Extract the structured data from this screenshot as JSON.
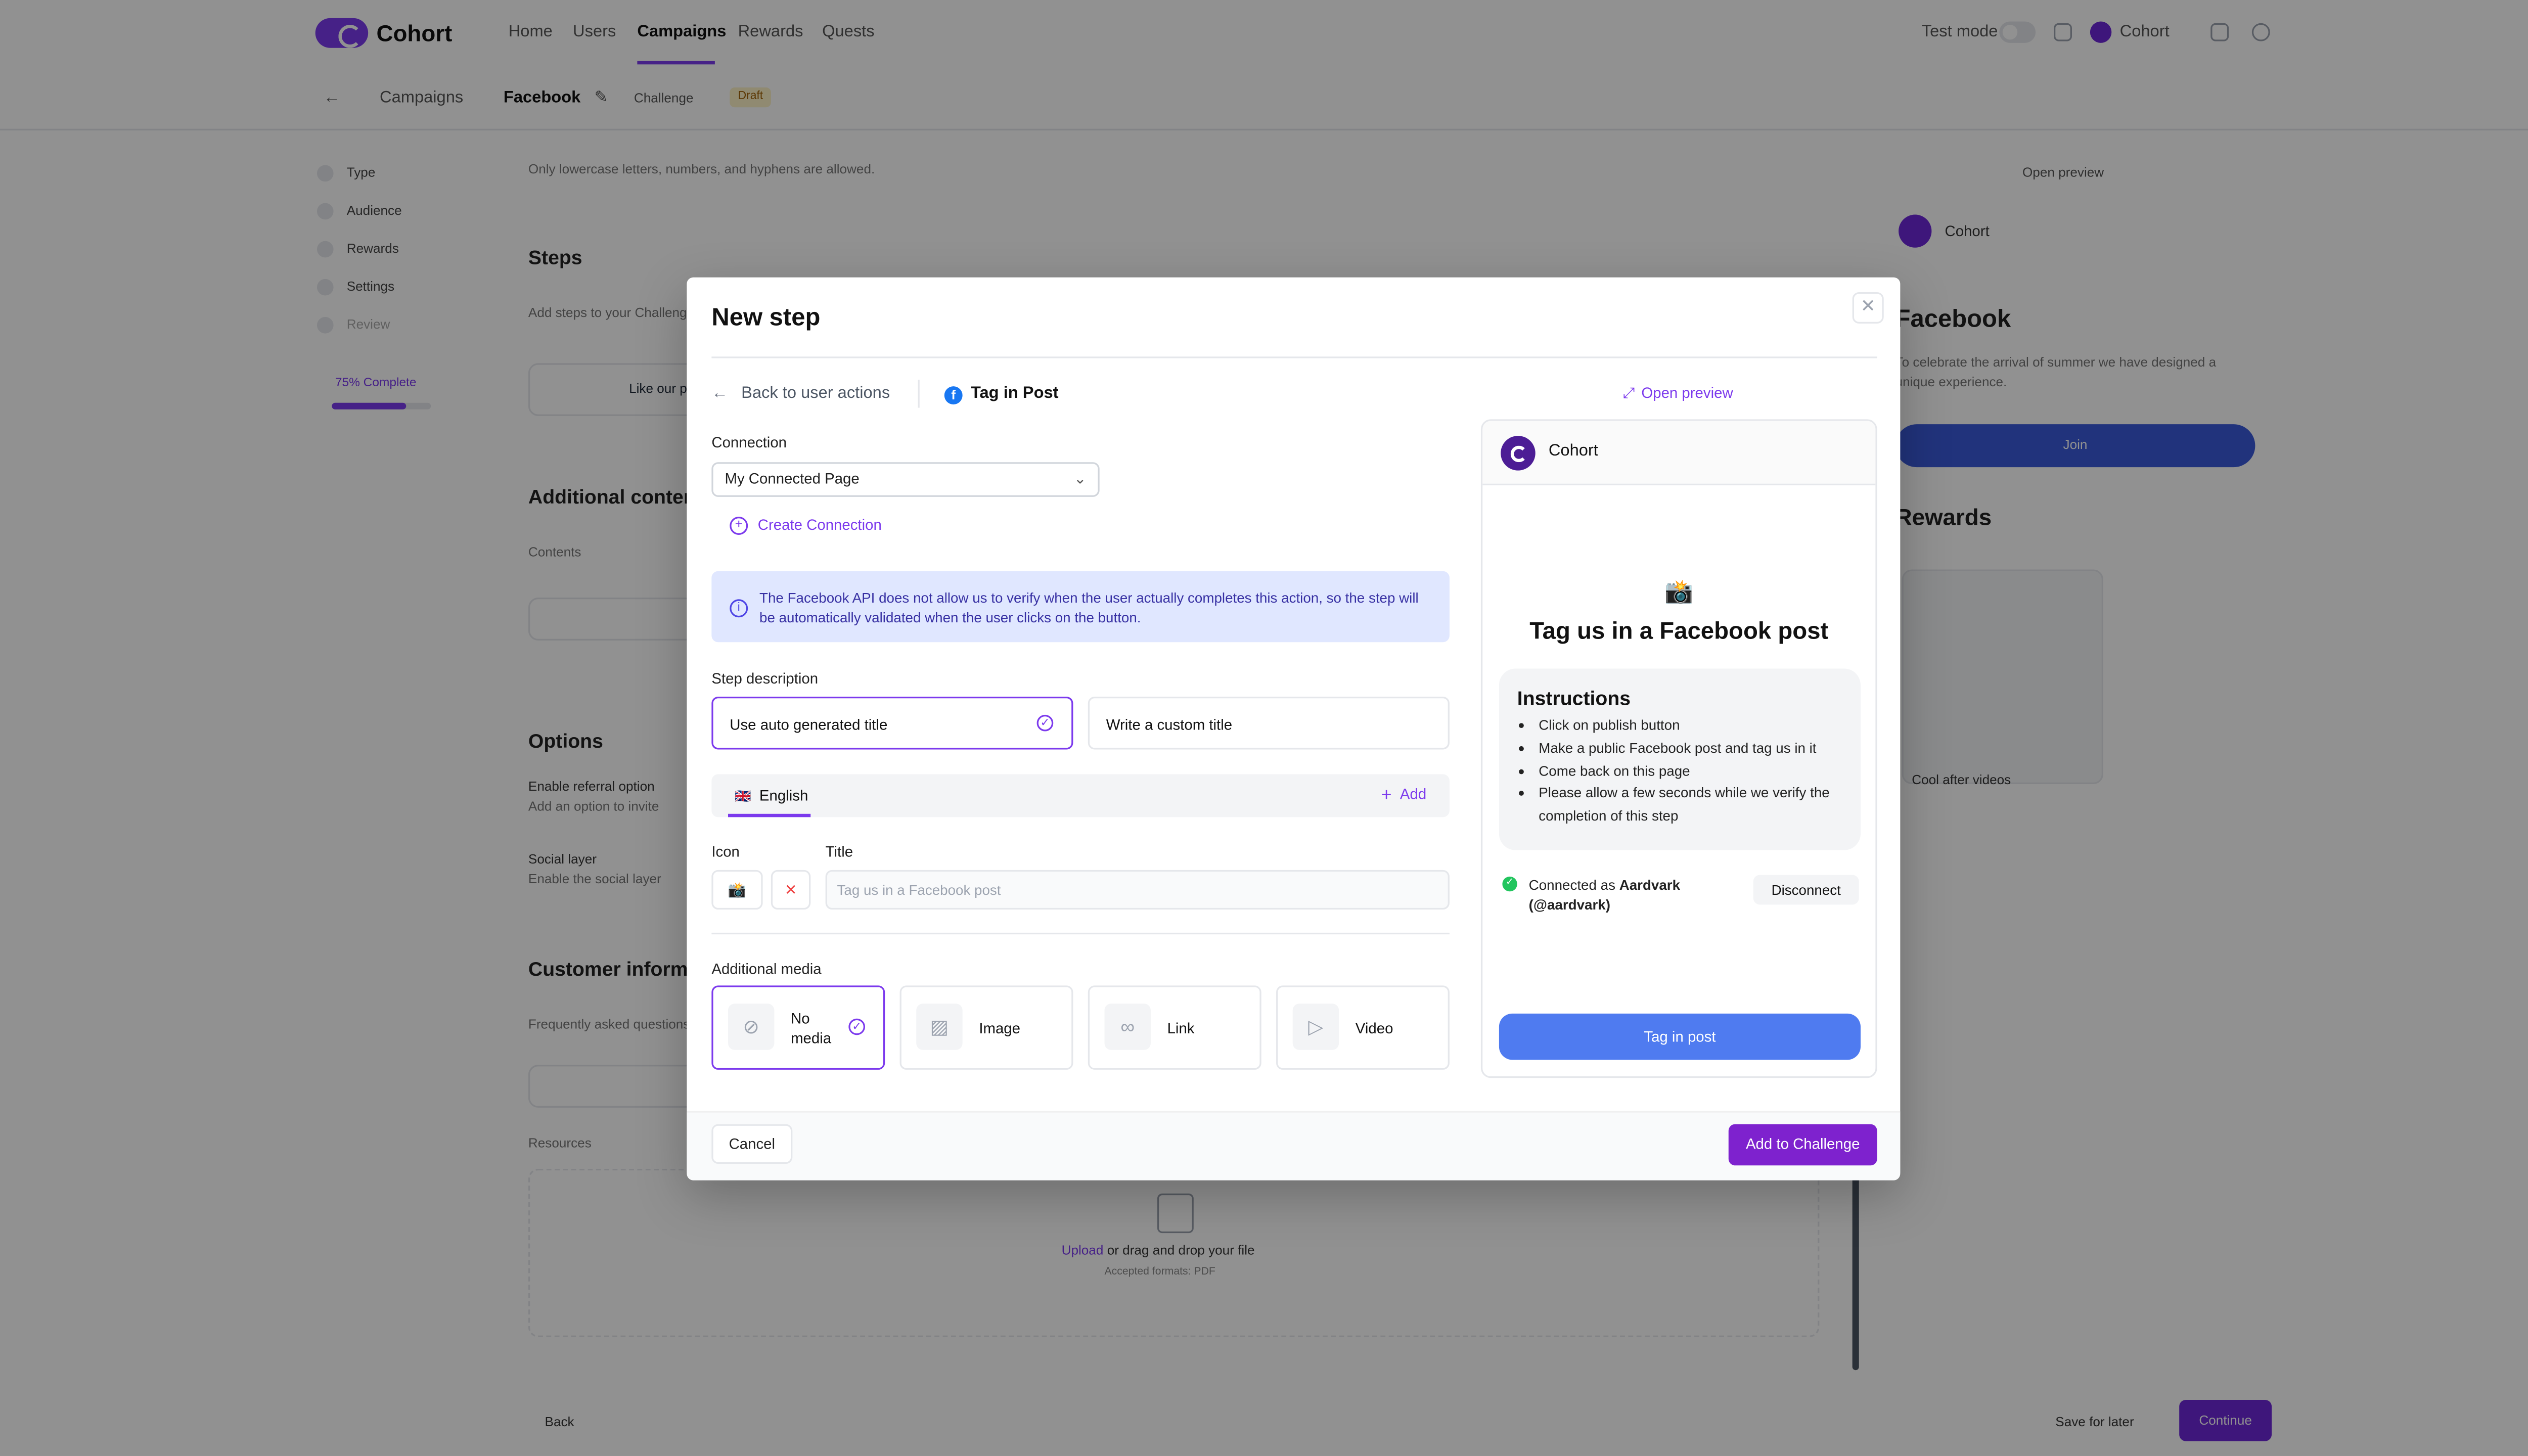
{
  "app": {
    "logo": "Cohort",
    "nav": [
      "Home",
      "Users",
      "Campaigns",
      "Rewards",
      "Quests"
    ],
    "nav_active": "Campaigns",
    "test_mode": "Test mode",
    "account": "Cohort"
  },
  "subbar": {
    "breadcrumb": [
      "Campaigns",
      "Facebook"
    ],
    "platform": "Challenge",
    "status": "Draft"
  },
  "sidebar": {
    "items": [
      "Type",
      "Audience",
      "Rewards",
      "Settings",
      "Review"
    ],
    "progress_text": "75% Complete",
    "progress": 0.75
  },
  "background": {
    "hint": "Only lowercase letters, numbers, and hyphens are allowed.",
    "steps_heading": "Steps",
    "steps_sub": "Add steps to your Challenge",
    "step_item": "Like our page",
    "additional_heading": "Additional content",
    "contents_label": "Contents",
    "options_heading": "Options",
    "opt1_title": "Enable referral option",
    "opt1_desc": "Add an option to invite",
    "opt2_title": "Social layer",
    "opt2_desc": "Enable the social layer",
    "customer_heading": "Customer information",
    "faq_label": "Frequently asked questions",
    "resources_label": "Resources",
    "upload_link": "Upload",
    "upload_text": "or drag and drop your file",
    "upload_hint": "Accepted formats: PDF",
    "back_btn": "Back",
    "save_later": "Save for later",
    "continue": "Continue",
    "preview_title": "Facebook",
    "preview_desc": "To celebrate the arrival of summer we have designed a unique experience.",
    "preview_join": "Join",
    "preview_rewards": "Rewards",
    "preview_reward_name": "Cool after videos",
    "open_preview": "Open preview",
    "preview_brand": "Cohort"
  },
  "modal": {
    "title": "New step",
    "back_label": "Back to user actions",
    "action_title": "Tag in Post",
    "connection_label": "Connection",
    "connection_value": "My Connected Page",
    "create_connection": "Create Connection",
    "info_text": "The Facebook API does not allow us to verify when the user actually completes this action, so the step will be automatically validated when the user clicks on the button.",
    "step_description_label": "Step description",
    "title_options": [
      "Use auto generated title",
      "Write a custom title"
    ],
    "title_option_selected": 0,
    "language_flag": "🇬🇧",
    "language": "English",
    "add_label": "Add",
    "icon_label": "Icon",
    "icon_value": "📸",
    "title_label": "Title",
    "title_placeholder": "Tag us in a Facebook post",
    "additional_media_label": "Additional media",
    "media_options": [
      {
        "label": "No media",
        "icon": "ban-icon"
      },
      {
        "label": "Image",
        "icon": "image-icon"
      },
      {
        "label": "Link",
        "icon": "link-icon"
      },
      {
        "label": "Video",
        "icon": "video-icon"
      }
    ],
    "media_selected": 0,
    "cancel": "Cancel",
    "submit": "Add to Challenge"
  },
  "preview": {
    "open_preview": "Open preview",
    "brand": "Cohort",
    "emoji": "📸",
    "title": "Tag us in a Facebook post",
    "instructions_heading": "Instructions",
    "instructions": [
      "Click on publish button",
      "Make a public Facebook post and tag us in it",
      "Come back on this page",
      "Please allow a few seconds while we verify the completion of this step"
    ],
    "connected_prefix": "Connected as",
    "connected_user": "Aardvark (@aardvark)",
    "disconnect": "Disconnect",
    "cta": "Tag in post"
  },
  "colors": {
    "accent": "#7c3aed",
    "primary_button": "#7e22ce",
    "info_bg": "#e0e7ff",
    "cta_blue": "#4f7bf0",
    "success": "#22c55e"
  }
}
